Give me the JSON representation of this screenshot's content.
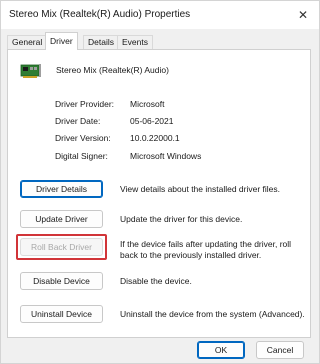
{
  "window": {
    "title": "Stereo Mix (Realtek(R) Audio) Properties",
    "close_glyph": "✕"
  },
  "tabs": [
    {
      "label": "General"
    },
    {
      "label": "Driver"
    },
    {
      "label": "Details"
    },
    {
      "label": "Events"
    }
  ],
  "active_tab": "Driver",
  "device": {
    "name": "Stereo Mix (Realtek(R) Audio)",
    "icon": "audio-card-icon"
  },
  "info": [
    {
      "label": "Driver Provider:",
      "value": "Microsoft"
    },
    {
      "label": "Driver Date:",
      "value": "05-06-2021"
    },
    {
      "label": "Driver Version:",
      "value": "10.0.22000.1"
    },
    {
      "label": "Digital Signer:",
      "value": "Microsoft Windows"
    }
  ],
  "actions": [
    {
      "button": "Driver Details",
      "description": "View details about the installed driver files."
    },
    {
      "button": "Update Driver",
      "description": "Update the driver for this device."
    },
    {
      "button": "Roll Back Driver",
      "description": "If the device fails after updating the driver, roll back to the previously installed driver."
    },
    {
      "button": "Disable Device",
      "description": "Disable the device."
    },
    {
      "button": "Uninstall Device",
      "description": "Uninstall the device from the system (Advanced)."
    }
  ],
  "footer": {
    "ok_label": "OK",
    "cancel_label": "Cancel"
  },
  "colors": {
    "accent": "#0067c0",
    "highlight": "#d13438",
    "disabled_text": "#a8a8a8"
  }
}
